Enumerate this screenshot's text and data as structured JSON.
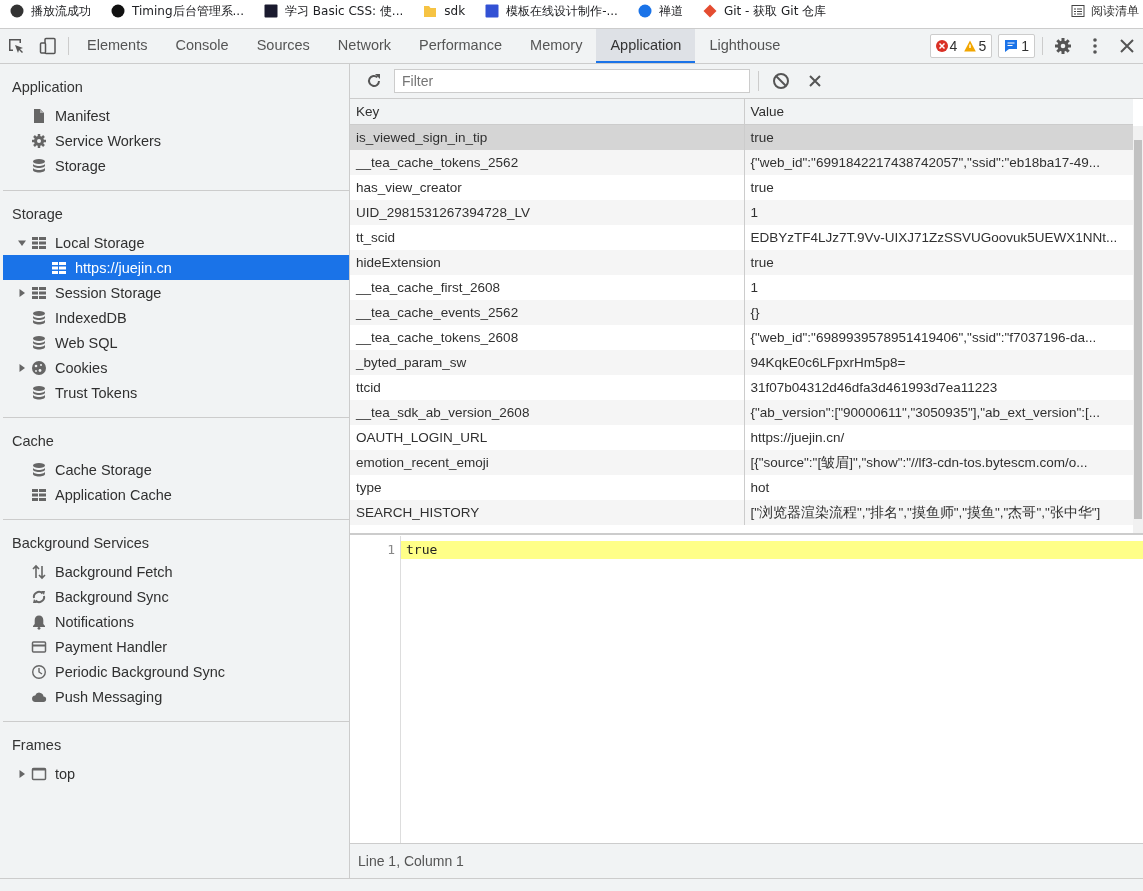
{
  "bookmarks": [
    {
      "label": "播放流成功",
      "kind": "round"
    },
    {
      "label": "Timing后台管理系...",
      "kind": "round"
    },
    {
      "label": "学习 Basic CSS: 使...",
      "kind": "square"
    },
    {
      "label": "sdk",
      "kind": "folder"
    },
    {
      "label": "模板在线设计制作-...",
      "kind": "square"
    },
    {
      "label": "禅道",
      "kind": "round"
    },
    {
      "label": "Git - 获取 Git 仓库",
      "kind": "diamond"
    }
  ],
  "reading_list": {
    "label": "阅读清单"
  },
  "devtools_tabs": [
    {
      "label": "Elements",
      "selected": false
    },
    {
      "label": "Console",
      "selected": false
    },
    {
      "label": "Sources",
      "selected": false
    },
    {
      "label": "Network",
      "selected": false
    },
    {
      "label": "Performance",
      "selected": false
    },
    {
      "label": "Memory",
      "selected": false
    },
    {
      "label": "Application",
      "selected": true
    },
    {
      "label": "Lighthouse",
      "selected": false
    }
  ],
  "counters": {
    "errors": "4",
    "warnings": "5",
    "messages": "1"
  },
  "sidebar": {
    "sections": [
      {
        "title": "Application",
        "items": [
          {
            "label": "Manifest",
            "kind": "file",
            "selected": false
          },
          {
            "label": "Service Workers",
            "kind": "gear",
            "selected": false
          },
          {
            "label": "Storage",
            "kind": "db",
            "selected": false
          }
        ]
      },
      {
        "title": "Storage",
        "items": [
          {
            "label": "Local Storage",
            "kind": "grid",
            "selected": false,
            "expanded": true,
            "children": [
              {
                "label": "https://juejin.cn",
                "kind": "grid",
                "selected": true
              }
            ]
          },
          {
            "label": "Session Storage",
            "kind": "grid",
            "selected": false,
            "expanded": false
          },
          {
            "label": "IndexedDB",
            "kind": "db",
            "selected": false
          },
          {
            "label": "Web SQL",
            "kind": "db",
            "selected": false
          },
          {
            "label": "Cookies",
            "kind": "cookie",
            "selected": false,
            "expanded": false
          },
          {
            "label": "Trust Tokens",
            "kind": "db",
            "selected": false
          }
        ]
      },
      {
        "title": "Cache",
        "items": [
          {
            "label": "Cache Storage",
            "kind": "db",
            "selected": false
          },
          {
            "label": "Application Cache",
            "kind": "grid",
            "selected": false
          }
        ]
      },
      {
        "title": "Background Services",
        "items": [
          {
            "label": "Background Fetch",
            "kind": "updown",
            "selected": false
          },
          {
            "label": "Background Sync",
            "kind": "sync",
            "selected": false
          },
          {
            "label": "Notifications",
            "kind": "bell",
            "selected": false
          },
          {
            "label": "Payment Handler",
            "kind": "card",
            "selected": false
          },
          {
            "label": "Periodic Background Sync",
            "kind": "clock",
            "selected": false
          },
          {
            "label": "Push Messaging",
            "kind": "cloud",
            "selected": false
          }
        ]
      },
      {
        "title": "Frames",
        "items": [
          {
            "label": "top",
            "kind": "frame",
            "selected": false,
            "expanded": false
          }
        ]
      }
    ]
  },
  "filter": {
    "placeholder": "Filter"
  },
  "table": {
    "columns": [
      "Key",
      "Value"
    ],
    "rows": [
      {
        "key": "is_viewed_sign_in_tip",
        "value": "true",
        "selected": true
      },
      {
        "key": "__tea_cache_tokens_2562",
        "value": "{\"web_id\":\"6991842217438742057\",\"ssid\":\"eb18ba17-49...",
        "selected": false
      },
      {
        "key": "has_view_creator",
        "value": "true",
        "selected": false
      },
      {
        "key": "UID_2981531267394728_LV",
        "value": "1",
        "selected": false
      },
      {
        "key": "tt_scid",
        "value": "EDBYzTF4LJz7T.9Vv-UIXJ71ZzSSVUGoovuk5UEWX1NNt...",
        "selected": false
      },
      {
        "key": "hideExtension",
        "value": "true",
        "selected": false
      },
      {
        "key": "__tea_cache_first_2608",
        "value": "1",
        "selected": false
      },
      {
        "key": "__tea_cache_events_2562",
        "value": "{}",
        "selected": false
      },
      {
        "key": "__tea_cache_tokens_2608",
        "value": "{\"web_id\":\"6989939578951419406\",\"ssid\":\"f7037196-da...",
        "selected": false
      },
      {
        "key": "_byted_param_sw",
        "value": "94KqkE0c6LFpxrHm5p8=",
        "selected": false
      },
      {
        "key": "ttcid",
        "value": "31f07b04312d46dfa3d461993d7ea11223",
        "selected": false
      },
      {
        "key": "__tea_sdk_ab_version_2608",
        "value": "{\"ab_version\":[\"90000611\",\"3050935\"],\"ab_ext_version\":[...",
        "selected": false
      },
      {
        "key": "OAUTH_LOGIN_URL",
        "value": "https://juejin.cn/",
        "selected": false
      },
      {
        "key": "emotion_recent_emoji",
        "value": "[{\"source\":\"[皱眉]\",\"show\":\"//lf3-cdn-tos.bytescm.com/o...",
        "selected": false
      },
      {
        "key": "type",
        "value": "hot",
        "selected": false
      },
      {
        "key": "SEARCH_HISTORY",
        "value": "[\"浏览器渲染流程\",\"排名\",\"摸鱼师\",\"摸鱼\",\"杰哥\",\"张中华\"]",
        "selected": false
      }
    ]
  },
  "editor": {
    "lines": [
      {
        "number": "1",
        "text": "true"
      }
    ]
  },
  "status_bar": {
    "text": "Line 1, Column 1"
  }
}
